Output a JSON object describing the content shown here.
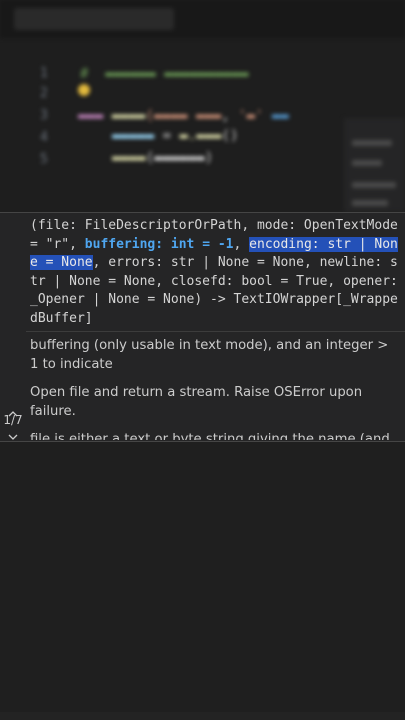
{
  "signature": {
    "prefix": "(file: FileDescriptorOrPath, mode: OpenTextMode = \"r\", ",
    "active_param": "buffering: int = -1",
    "mid": ", ",
    "highlighted": "encoding: str | None = None",
    "suffix": ", errors: str | None = None, newline: str | None = None, closefd: bool = True, opener: _Opener | None = None) -> TextIOWrapper[_WrappedBuffer]"
  },
  "docs": [
    "buffering (only usable in text mode), and an integer > 1 to indicate",
    "Open file and return a stream. Raise OSError upon failure.",
    "file is either a text or byte string giving the name (and the path if the file isn't in the current working directory) of the"
  ],
  "overload_nav": {
    "up_icon": "chevron-up-icon",
    "count": "1/7",
    "down_icon": "chevron-down-icon"
  },
  "colors": {
    "background": "#1f1f1f",
    "widget": "#252526",
    "active_param": "#4fa6f0",
    "highlight": "#2451b8"
  }
}
